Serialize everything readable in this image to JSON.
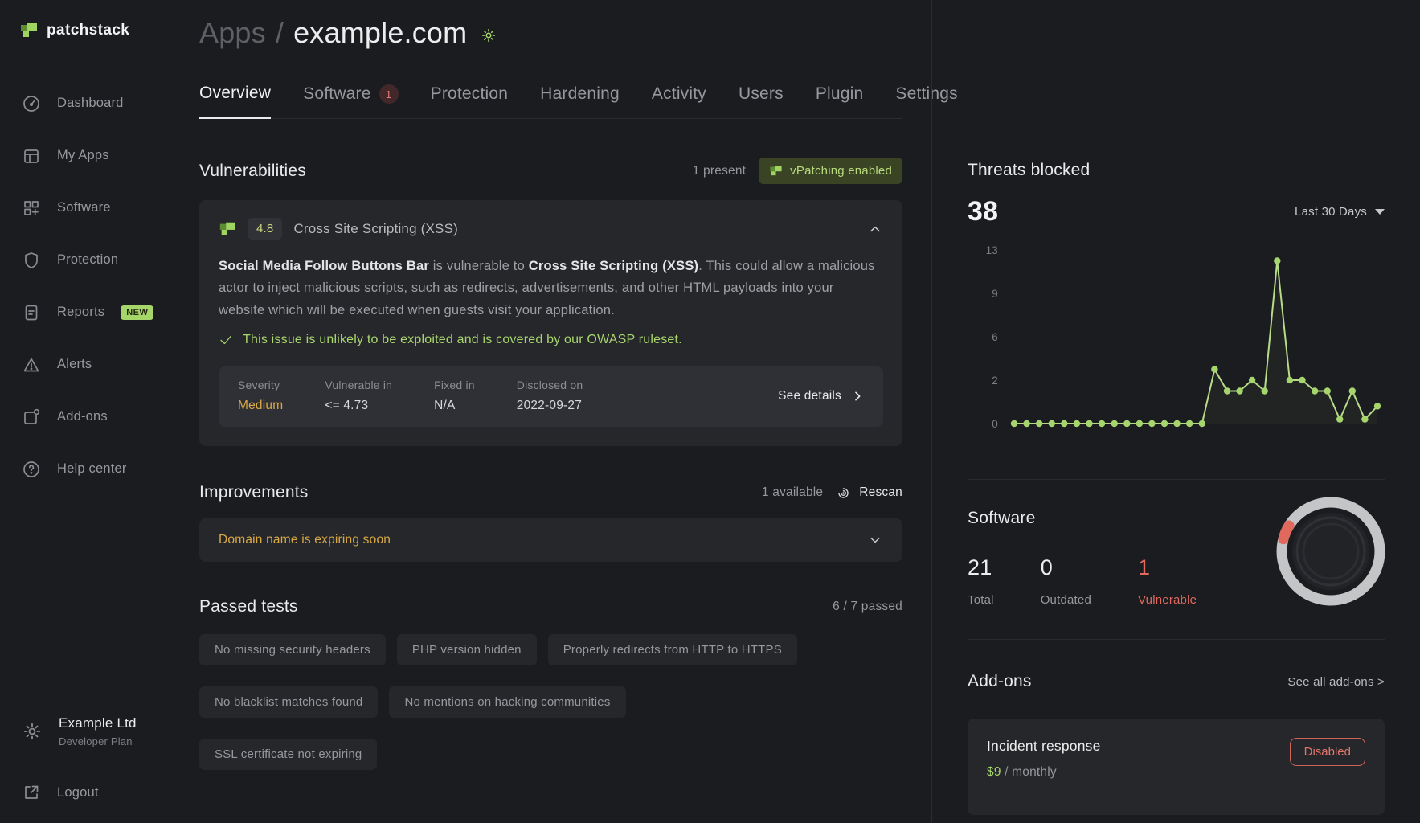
{
  "brand": {
    "name": "patchstack"
  },
  "sidebar": {
    "items": [
      {
        "label": "Dashboard"
      },
      {
        "label": "My Apps"
      },
      {
        "label": "Software"
      },
      {
        "label": "Protection"
      },
      {
        "label": "Reports",
        "badge": "NEW"
      },
      {
        "label": "Alerts"
      },
      {
        "label": "Add-ons"
      },
      {
        "label": "Help center"
      }
    ],
    "org": {
      "name": "Example Ltd",
      "plan": "Developer Plan"
    },
    "logout_label": "Logout"
  },
  "breadcrumb": {
    "root": "Apps",
    "separator": "/",
    "current": "example.com"
  },
  "tabs": [
    {
      "label": "Overview"
    },
    {
      "label": "Software",
      "badge": "1"
    },
    {
      "label": "Protection"
    },
    {
      "label": "Hardening"
    },
    {
      "label": "Activity"
    },
    {
      "label": "Users"
    },
    {
      "label": "Plugin"
    },
    {
      "label": "Settings"
    }
  ],
  "vulnerabilities": {
    "heading": "Vulnerabilities",
    "present": "1 present",
    "vpatching_badge": "vPatching enabled",
    "score": "4.8",
    "title": "Cross Site Scripting (XSS)",
    "description": {
      "plugin": "Social Media Follow Buttons Bar",
      "mid": " is vulnerable to ",
      "vuln": "Cross Site Scripting (XSS)",
      "rest": ". This could allow a malicious actor to inject malicious scripts, such as redirects, advertisements, and other HTML payloads into your website which will be executed when guests visit your application."
    },
    "note": "This issue is unlikely to be exploited and is covered by our OWASP ruleset.",
    "details": [
      {
        "label": "Severity",
        "value": "Medium"
      },
      {
        "label": "Vulnerable in",
        "value": "<= 4.73"
      },
      {
        "label": "Fixed in",
        "value": "N/A"
      },
      {
        "label": "Disclosed on",
        "value": "2022-09-27"
      }
    ],
    "see_details": "See details"
  },
  "improvements": {
    "heading": "Improvements",
    "available": "1 available",
    "rescan_label": "Rescan",
    "item": "Domain name is expiring soon"
  },
  "passed_tests": {
    "heading": "Passed tests",
    "summary": "6 / 7 passed",
    "items": [
      "No missing security headers",
      "PHP version hidden",
      "Properly redirects from HTTP to HTTPS",
      "No blacklist matches found",
      "No mentions on hacking communities",
      "SSL certificate not expiring"
    ]
  },
  "threats": {
    "heading": "Threats blocked",
    "count": "38",
    "range_label": "Last 30 Days"
  },
  "chart_data": {
    "type": "line",
    "title": "Threats blocked - Last 30 Days",
    "y_ticks": [
      0,
      2,
      6,
      9,
      13
    ],
    "values": [
      0,
      0,
      0,
      0,
      0,
      0,
      0,
      0,
      0,
      0,
      0,
      0,
      0,
      0,
      0,
      0,
      3,
      1.5,
      1.5,
      2,
      1.5,
      12,
      2,
      2,
      1.5,
      1.5,
      0.2,
      1.5,
      0.2,
      0.8
    ],
    "line_color": "#b7db88",
    "dot_color": "#a7d56d",
    "grid": false,
    "legend": "none"
  },
  "software": {
    "heading": "Software",
    "stats": [
      {
        "value": "21",
        "label": "Total"
      },
      {
        "value": "0",
        "label": "Outdated"
      },
      {
        "value": "1",
        "label": "Vulnerable"
      }
    ],
    "donut": {
      "total": 21,
      "vulnerable": 1,
      "ring_color": "#c4c5c7",
      "alert_color": "#e0685c"
    }
  },
  "addons": {
    "heading": "Add-ons",
    "see_all": "See all add-ons >",
    "card": {
      "title": "Incident response",
      "price": "$9",
      "period": " / monthly",
      "status": "Disabled"
    }
  },
  "colors": {
    "accent_green": "#a5d46a",
    "warning_yellow": "#d9a945",
    "danger_red": "#e0685c",
    "badge_olive_bg": "#3a4323"
  }
}
